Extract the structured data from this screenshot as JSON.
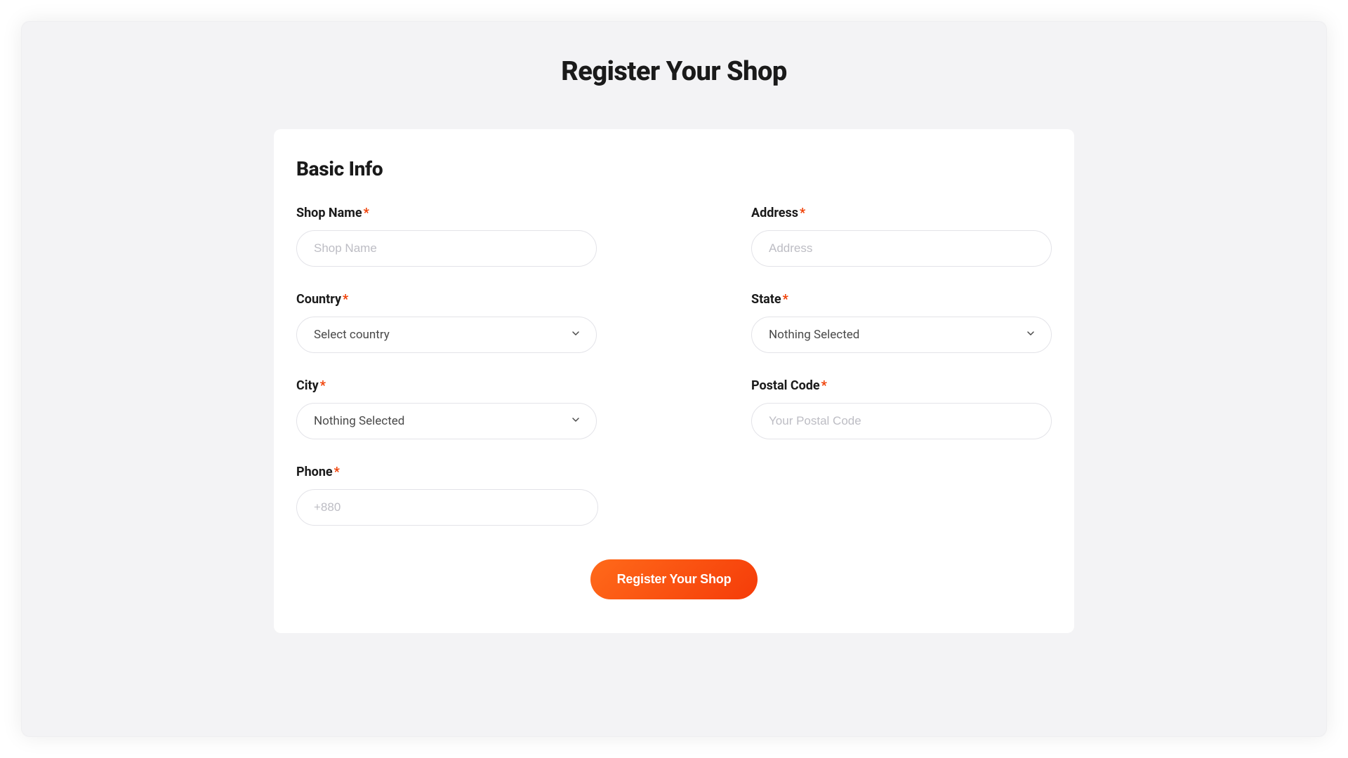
{
  "page": {
    "title": "Register Your Shop"
  },
  "section": {
    "title": "Basic Info"
  },
  "fields": {
    "shop_name": {
      "label": "Shop Name",
      "placeholder": "Shop Name",
      "required": "*"
    },
    "address": {
      "label": "Address",
      "placeholder": "Address",
      "required": "*"
    },
    "country": {
      "label": "Country",
      "selected": "Select country",
      "required": "*"
    },
    "state": {
      "label": "State",
      "selected": "Nothing Selected",
      "required": "*"
    },
    "city": {
      "label": "City",
      "selected": "Nothing Selected",
      "required": "*"
    },
    "postal_code": {
      "label": "Postal Code",
      "placeholder": "Your Postal Code",
      "required": "*"
    },
    "phone": {
      "label": "Phone",
      "placeholder": "+880",
      "required": "*"
    }
  },
  "submit": {
    "label": "Register Your Shop"
  }
}
